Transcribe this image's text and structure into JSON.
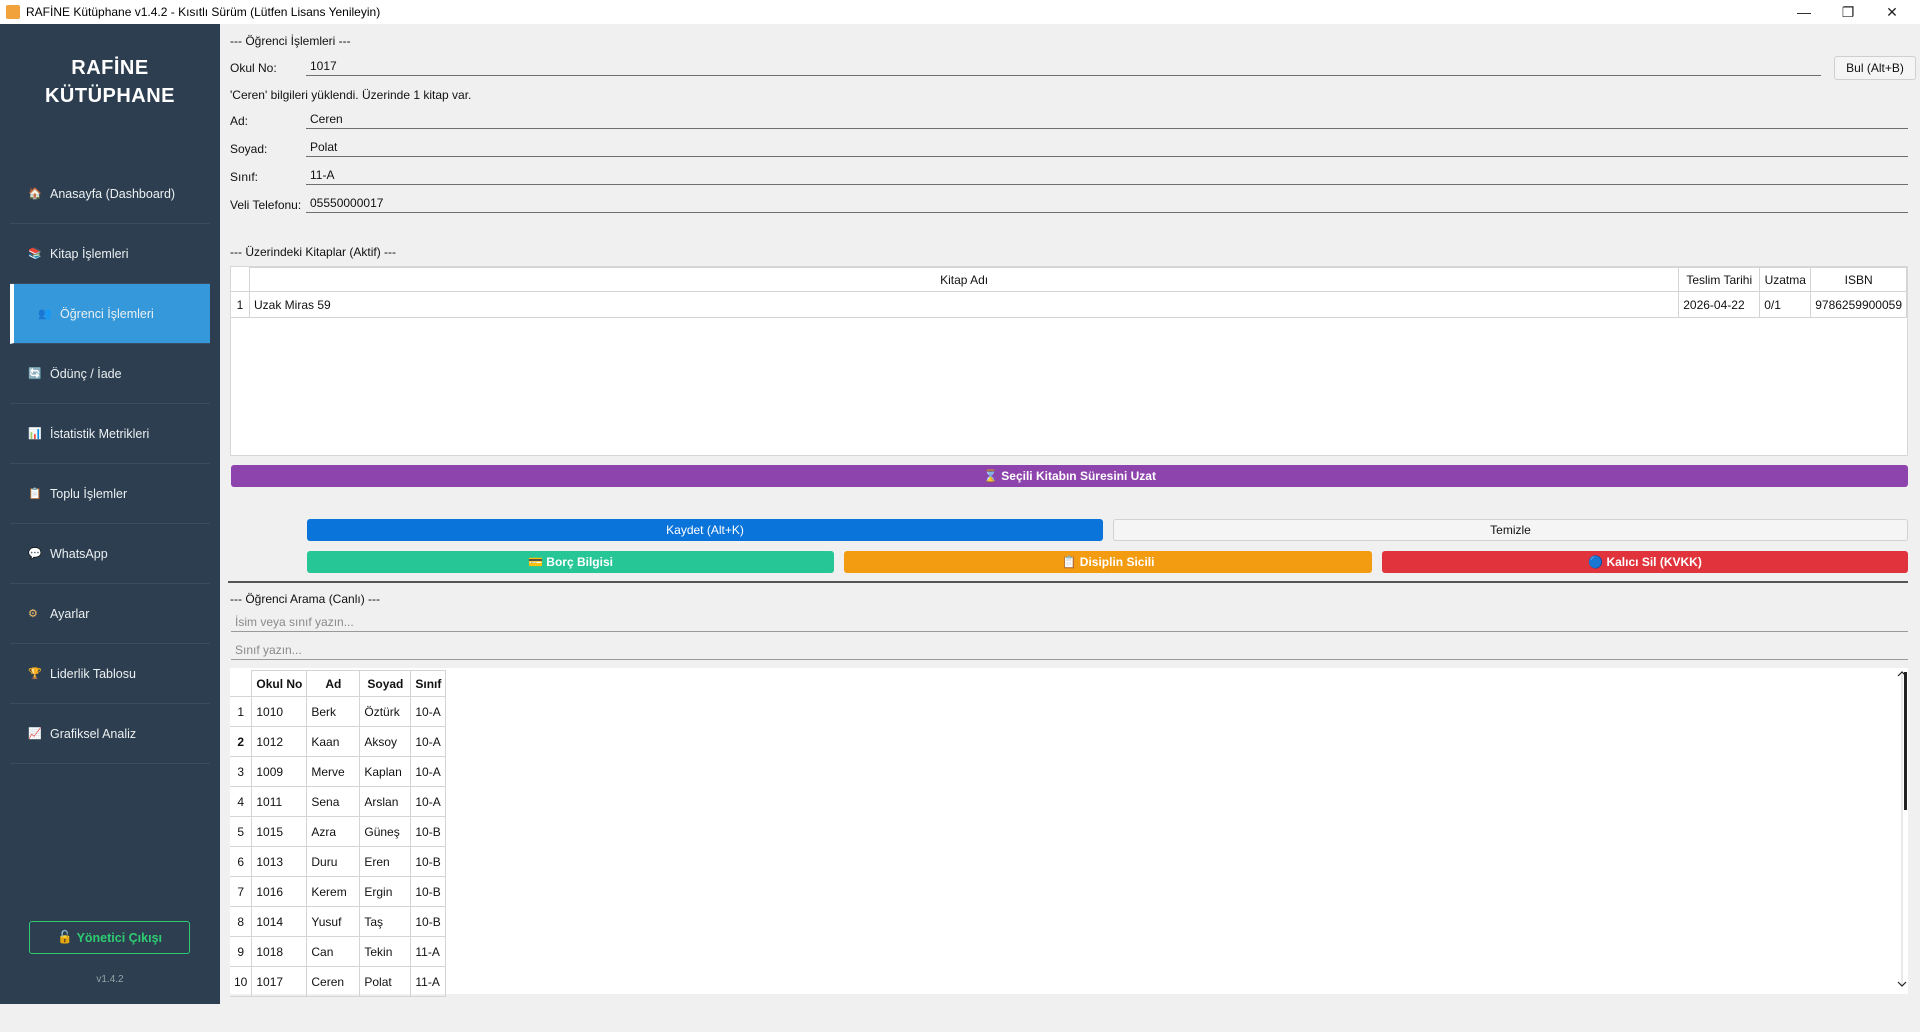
{
  "window": {
    "title": "RAFİNE Kütüphane v1.4.2 - Kısıtlı Sürüm (Lütfen Lisans Yenileyin)",
    "controls": {
      "minimize": "—",
      "restore": "❐",
      "close": "✕"
    }
  },
  "sidebar": {
    "brand_line1": "RAFİNE",
    "brand_line2": "KÜTÜPHANE",
    "items": [
      {
        "label": "Anasayfa (Dashboard)",
        "icon": "🏠"
      },
      {
        "label": "Kitap İşlemleri",
        "icon": "📚"
      },
      {
        "label": "Öğrenci İşlemleri",
        "icon": "👥"
      },
      {
        "label": "Ödünç / İade",
        "icon": "🔄"
      },
      {
        "label": "İstatistik Metrikleri",
        "icon": "📊"
      },
      {
        "label": "Toplu İşlemler",
        "icon": "📋"
      },
      {
        "label": "WhatsApp",
        "icon": "💬"
      },
      {
        "label": "Ayarlar",
        "icon": "⚙"
      },
      {
        "label": "Liderlik Tablosu",
        "icon": "🏆"
      },
      {
        "label": "Grafiksel Analiz",
        "icon": "📈"
      }
    ],
    "logout_label": "Yönetici Çıkışı",
    "logout_icon": "🔓",
    "version": "v1.4.2"
  },
  "student": {
    "section_title": "--- Öğrenci İşlemleri ---",
    "okul_no_label": "Okul No:",
    "okul_no_value": "1017",
    "find_button": "Bul (Alt+B)",
    "status_message": "'Ceren' bilgileri yüklendi. Üzerinde 1 kitap var.",
    "ad_label": "Ad:",
    "ad_value": "Ceren",
    "soyad_label": "Soyad:",
    "soyad_value": "Polat",
    "sinif_label": "Sınıf:",
    "sinif_value": "11-A",
    "veli_label": "Veli Telefonu:",
    "veli_value": "05550000017"
  },
  "active_books": {
    "section_title": "--- Üzerindeki Kitaplar (Aktif) ---",
    "columns": [
      "Kitap Adı",
      "Teslim Tarihi",
      "Uzatma",
      "ISBN"
    ],
    "rows": [
      {
        "n": "1",
        "title": "Uzak Miras 59",
        "due": "2026-04-22",
        "ext": "0/1",
        "isbn": "9786259900059"
      }
    ]
  },
  "actions": {
    "extend_label": "⌛ Seçili Kitabın Süresini Uzat",
    "save_label": "Kaydet (Alt+K)",
    "clear_label": "Temizle",
    "debt_label": "💳 Borç Bilgisi",
    "discipline_label": "📋 Disiplin Sicili",
    "delete_label": "🔵 Kalıcı Sil (KVKK)",
    "colors": {
      "extend": "#8e44ad",
      "save": "#0a74da",
      "debt": "#27c696",
      "discipline": "#f39c12",
      "delete": "#e0333b"
    }
  },
  "search": {
    "section_title": "--- Öğrenci Arama (Canlı) ---",
    "name_placeholder": "İsim veya sınıf yazın...",
    "class_placeholder": "Sınıf yazın...",
    "columns": [
      "Okul No",
      "Ad",
      "Soyad",
      "Sınıf"
    ],
    "rows": [
      {
        "n": "1",
        "no": "1010",
        "ad": "Berk",
        "soyad": "Öztürk",
        "sinif": "10-A"
      },
      {
        "n": "2",
        "no": "1012",
        "ad": "Kaan",
        "soyad": "Aksoy",
        "sinif": "10-A"
      },
      {
        "n": "3",
        "no": "1009",
        "ad": "Merve",
        "soyad": "Kaplan",
        "sinif": "10-A"
      },
      {
        "n": "4",
        "no": "1011",
        "ad": "Sena",
        "soyad": "Arslan",
        "sinif": "10-A"
      },
      {
        "n": "5",
        "no": "1015",
        "ad": "Azra",
        "soyad": "Güneş",
        "sinif": "10-B"
      },
      {
        "n": "6",
        "no": "1013",
        "ad": "Duru",
        "soyad": "Eren",
        "sinif": "10-B"
      },
      {
        "n": "7",
        "no": "1016",
        "ad": "Kerem",
        "soyad": "Ergin",
        "sinif": "10-B"
      },
      {
        "n": "8",
        "no": "1014",
        "ad": "Yusuf",
        "soyad": "Taş",
        "sinif": "10-B"
      },
      {
        "n": "9",
        "no": "1018",
        "ad": "Can",
        "soyad": "Tekin",
        "sinif": "11-A"
      },
      {
        "n": "10",
        "no": "1017",
        "ad": "Ceren",
        "soyad": "Polat",
        "sinif": "11-A"
      }
    ]
  }
}
